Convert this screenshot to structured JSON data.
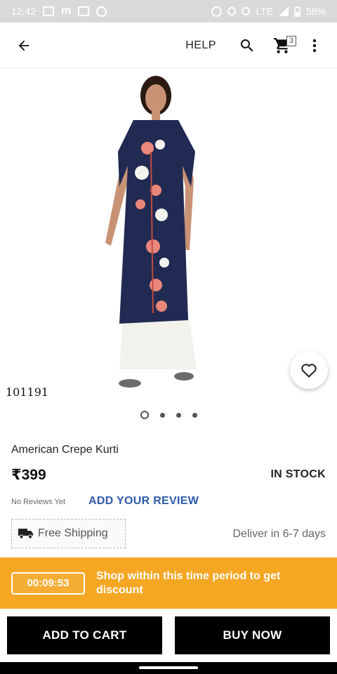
{
  "status_bar": {
    "time": "12:42",
    "network": "LTE",
    "battery": "58%"
  },
  "app_bar": {
    "help_label": "HELP",
    "cart_count": "3",
    "icons": [
      "back-arrow-icon",
      "search-icon",
      "cart-icon",
      "more-vert-icon"
    ]
  },
  "gallery": {
    "sku": "101191",
    "dots": 4,
    "active_dot": 0
  },
  "product": {
    "title": "American Crepe Kurti",
    "price": "₹399",
    "stock": "IN STOCK",
    "reviews": "No Reviews Yet",
    "add_review": "ADD YOUR REVIEW",
    "shipping": "Free Shipping",
    "delivery": "Deliver in 6-7 days"
  },
  "offer": {
    "timer": "00:09:53",
    "text": "Shop within this time period to get discount",
    "color": "#f5a623"
  },
  "actions": {
    "add_to_cart": "ADD TO CART",
    "buy_now": "BUY NOW"
  }
}
